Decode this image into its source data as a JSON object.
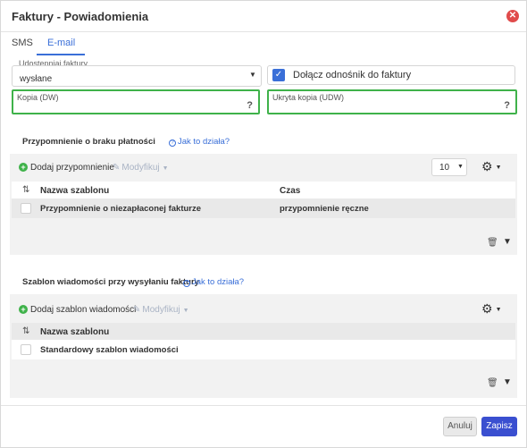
{
  "dialog": {
    "title": "Faktury - Powiadomienia",
    "close_icon": "close-icon",
    "close_color": "#e04b4b"
  },
  "tabs": [
    {
      "label": "SMS",
      "active": false
    },
    {
      "label": "E-mail",
      "active": true
    }
  ],
  "share_invoice": {
    "label": "Udostępniaj faktury",
    "value": "wysłane"
  },
  "attach_link": {
    "label": "Dołącz odnośnik do faktury",
    "checked": true
  },
  "cc": {
    "label": "Kopia (DW)",
    "value": "",
    "help": "?"
  },
  "bcc": {
    "label": "Ukryta kopia (UDW)",
    "value": "",
    "help": "?"
  },
  "reminders": {
    "title": "Przypomnienie o braku płatności",
    "help_link": "Jak to działa?",
    "add_label": "Dodaj przypomnienie",
    "edit_label": "Modyfikuj",
    "per_page": "10",
    "columns": [
      "Nazwa szablonu",
      "Czas"
    ],
    "rows": [
      {
        "name": "Przypomnienie o niezapłaconej fakturze",
        "time": "przypomnienie ręczne"
      }
    ]
  },
  "templates": {
    "title": "Szablon wiadomości przy wysyłaniu faktury",
    "help_link": "Jak to działa?",
    "add_label": "Dodaj szablon wiadomości",
    "edit_label": "Modyfikuj",
    "columns": [
      "Nazwa szablonu"
    ],
    "rows": [
      {
        "name": "Standardowy szablon wiadomości"
      }
    ]
  },
  "footer": {
    "cancel_label": "Anuluj",
    "save_label": "Zapisz"
  },
  "colors": {
    "accent": "#3a6fd8",
    "save_button": "#3a4fd0",
    "highlight_border": "#3fb24a",
    "add_icon": "#3fb24a"
  }
}
